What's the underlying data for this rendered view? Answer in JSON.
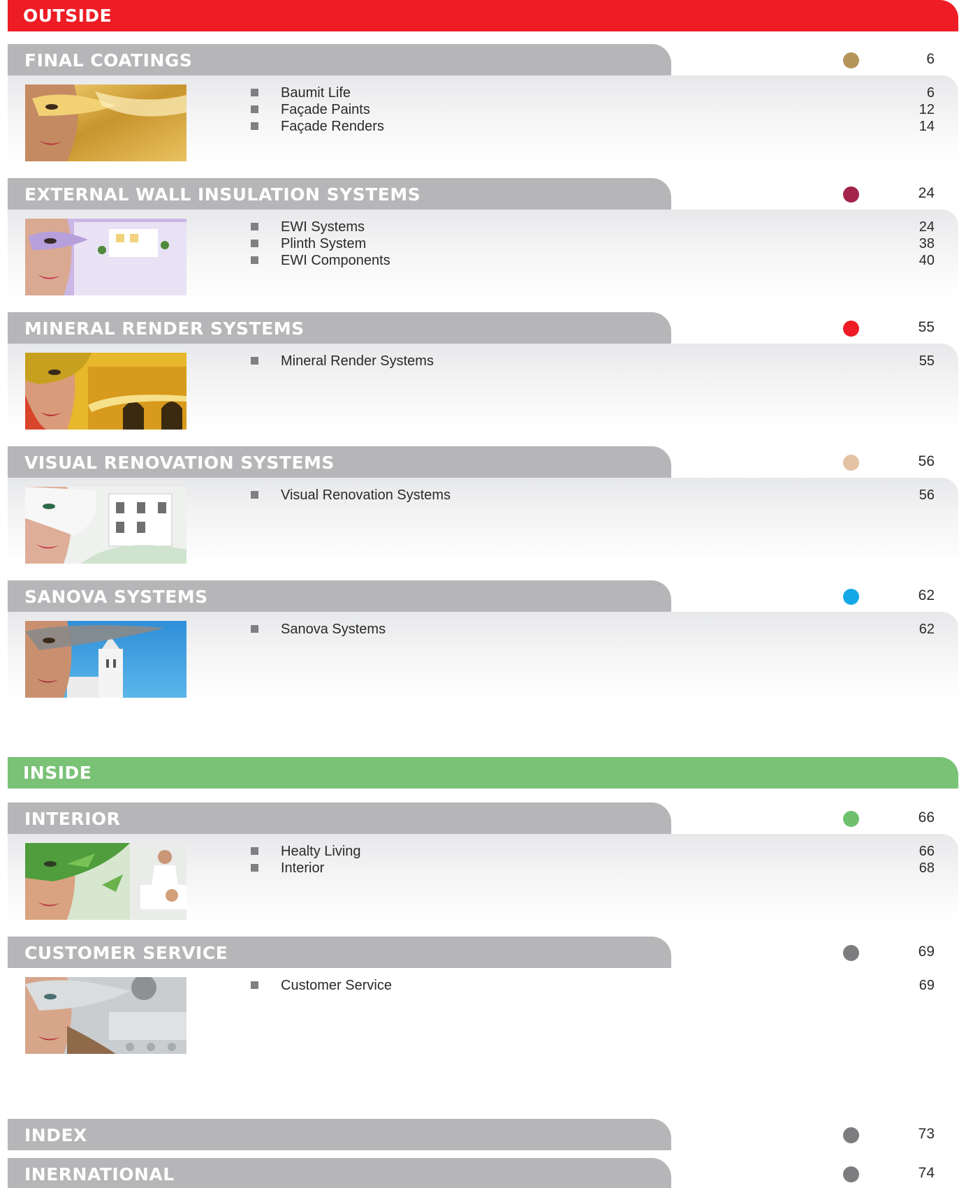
{
  "outside": {
    "title": "OUTSIDE",
    "color": "#ee1c25"
  },
  "inside": {
    "title": "INSIDE",
    "color": "#79c276"
  },
  "sections": [
    {
      "title": "FINAL COATINGS",
      "page": "6",
      "dot_color": "#b5945a",
      "thumb_icon": "gold-mask-thumbnail",
      "items": [
        {
          "label": "Baumit Life",
          "page": "6"
        },
        {
          "label": "Façade Paints",
          "page": "12"
        },
        {
          "label": "Façade Renders",
          "page": "14"
        }
      ]
    },
    {
      "title": "EXTERNAL WALL INSULATION SYSTEMS",
      "page": "24",
      "dot_color": "#a4234a",
      "thumb_icon": "purple-mask-thumbnail",
      "items": [
        {
          "label": "EWI Systems",
          "page": "24"
        },
        {
          "label": "Plinth System",
          "page": "38"
        },
        {
          "label": "EWI Components",
          "page": "40"
        }
      ]
    },
    {
      "title": "MINERAL RENDER SYSTEMS",
      "page": "55",
      "dot_color": "#ee1c25",
      "thumb_icon": "yellow-mask-thumbnail",
      "items": [
        {
          "label": "Mineral Render Systems",
          "page": "55"
        }
      ]
    },
    {
      "title": "VISUAL RENOVATION SYSTEMS",
      "page": "56",
      "dot_color": "#e4c2a4",
      "thumb_icon": "white-mask-thumbnail",
      "items": [
        {
          "label": "Visual Renovation Systems",
          "page": "56"
        }
      ]
    },
    {
      "title": "SANOVA SYSTEMS",
      "page": "62",
      "dot_color": "#14a9e6",
      "thumb_icon": "blue-sky-thumbnail",
      "items": [
        {
          "label": "Sanova Systems",
          "page": "62"
        }
      ]
    },
    {
      "title": "INTERIOR",
      "page": "66",
      "dot_color": "#6fc06d",
      "thumb_icon": "green-leaf-thumbnail",
      "items": [
        {
          "label": "Healty Living",
          "page": "66"
        },
        {
          "label": "Interior",
          "page": "68"
        }
      ]
    },
    {
      "title": "CUSTOMER SERVICE",
      "page": "69",
      "dot_color": "#7d7d7f",
      "thumb_icon": "grey-mask-thumbnail",
      "items": [
        {
          "label": "Customer Service",
          "page": "69"
        }
      ]
    },
    {
      "title": "INDEX",
      "page": "73",
      "dot_color": "#7d7d7f"
    },
    {
      "title": "INERNATIONAL",
      "page": "74",
      "dot_color": "#7d7d7f"
    }
  ]
}
